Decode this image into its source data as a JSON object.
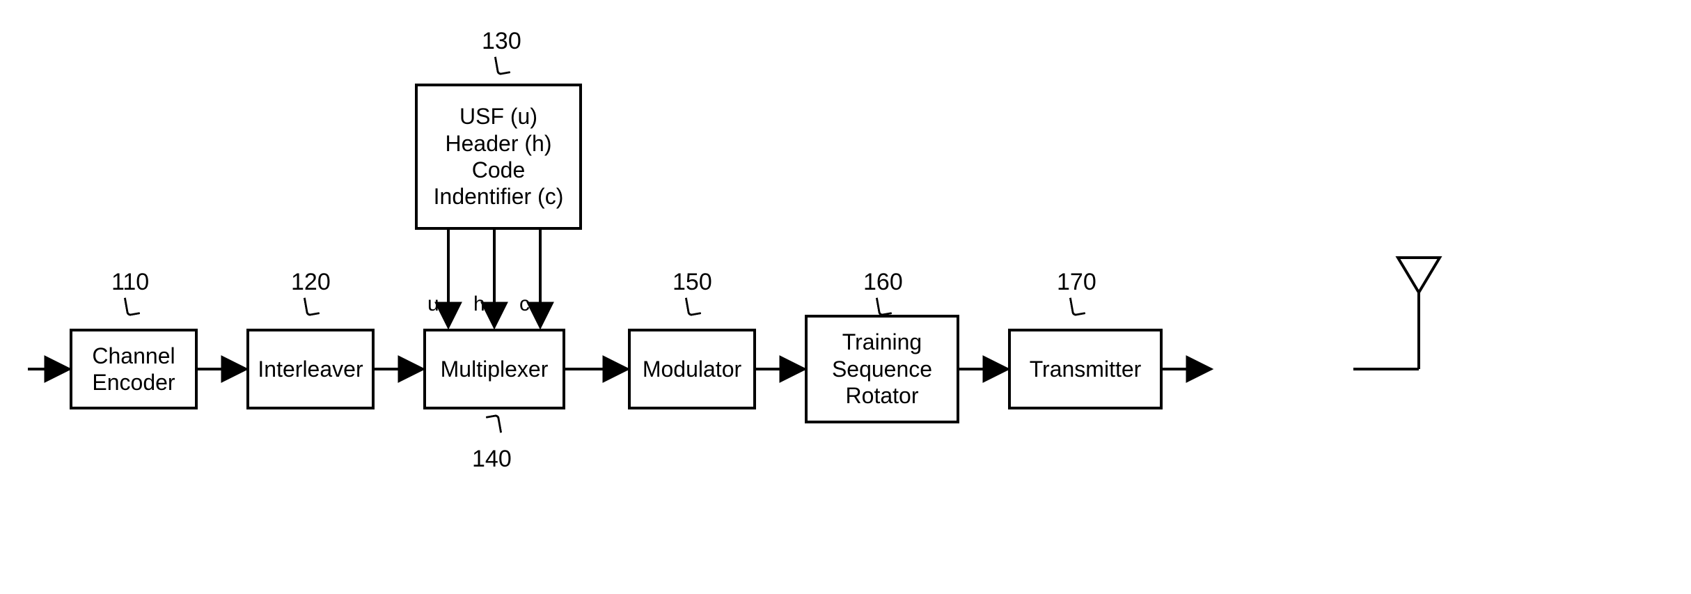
{
  "blocks": {
    "encoder": {
      "label": "Channel\nEncoder",
      "num": "110"
    },
    "interleaver": {
      "label": "Interleaver",
      "num": "120"
    },
    "infobox": {
      "lines": [
        "USF (u)",
        "Header (h)",
        "Code",
        "Indentifier (c)"
      ],
      "num": "130"
    },
    "mux": {
      "label": "Multiplexer",
      "num": "140"
    },
    "modulator": {
      "label": "Modulator",
      "num": "150"
    },
    "rotator": {
      "label": "Training\nSequence\nRotator",
      "num": "160"
    },
    "transmitter": {
      "label": "Transmitter",
      "num": "170"
    }
  },
  "signals": {
    "u": "u",
    "h": "h",
    "c": "c"
  }
}
